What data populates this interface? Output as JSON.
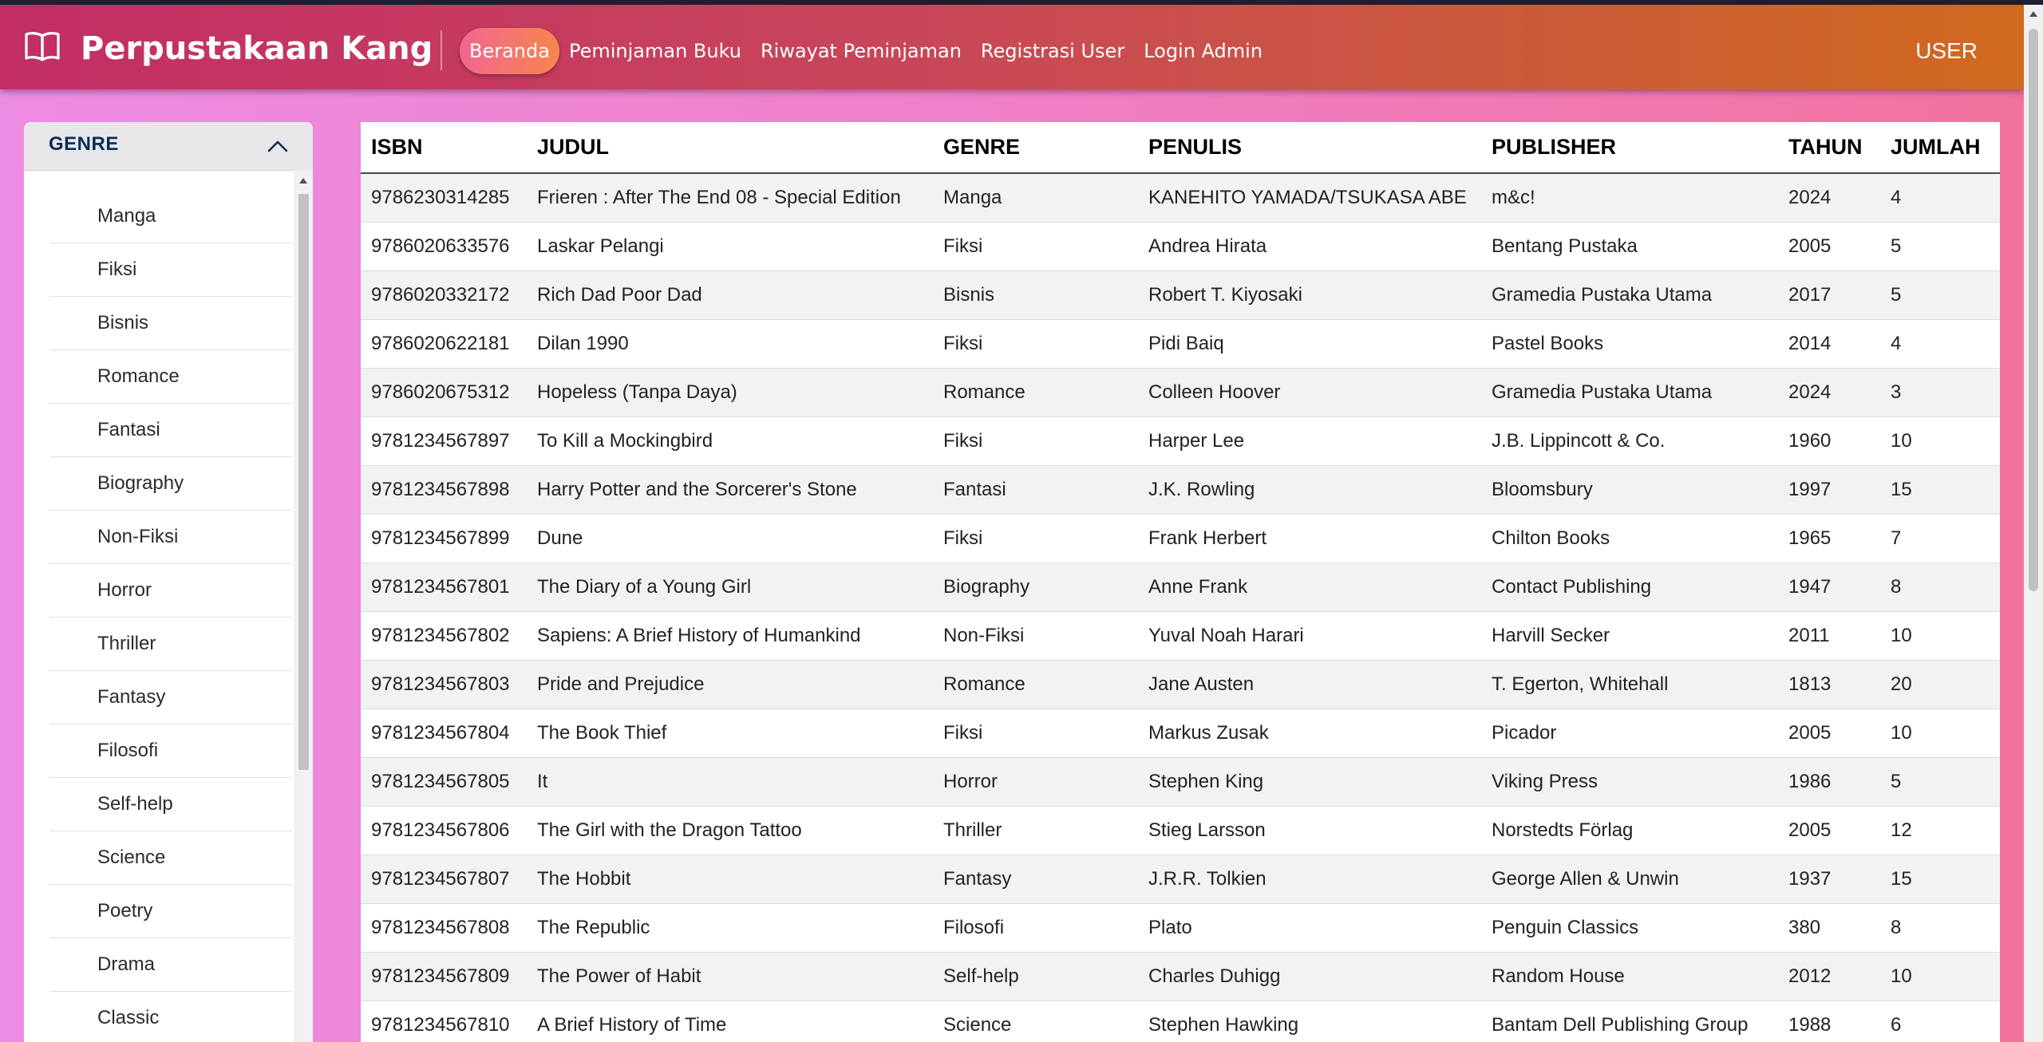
{
  "navbar": {
    "brand": "Perpustakaan Kang",
    "links": [
      "Beranda",
      "Peminjaman Buku",
      "Riwayat Peminjaman",
      "Registrasi User",
      "Login Admin"
    ],
    "user_label": "USER"
  },
  "sidebar": {
    "title": "GENRE",
    "genres": [
      "Manga",
      "Fiksi",
      "Bisnis",
      "Romance",
      "Fantasi",
      "Biography",
      "Non-Fiksi",
      "Horror",
      "Thriller",
      "Fantasy",
      "Filosofi",
      "Self-help",
      "Science",
      "Poetry",
      "Drama",
      "Classic"
    ]
  },
  "table": {
    "columns": [
      "ISBN",
      "JUDUL",
      "GENRE",
      "PENULIS",
      "PUBLISHER",
      "TAHUN",
      "JUMLAH"
    ],
    "rows": [
      [
        "9786230314285",
        "Frieren : After The End 08 - Special Edition",
        "Manga",
        "KANEHITO YAMADA/TSUKASA ABE",
        "m&c!",
        "2024",
        "4"
      ],
      [
        "9786020633576",
        "Laskar Pelangi",
        "Fiksi",
        "Andrea Hirata",
        "Bentang Pustaka",
        "2005",
        "5"
      ],
      [
        "9786020332172",
        "Rich Dad Poor Dad",
        "Bisnis",
        "Robert T. Kiyosaki",
        "Gramedia Pustaka Utama",
        "2017",
        "5"
      ],
      [
        "9786020622181",
        "Dilan 1990",
        "Fiksi",
        "Pidi Baiq",
        "Pastel Books",
        "2014",
        "4"
      ],
      [
        "9786020675312",
        "Hopeless (Tanpa Daya)",
        "Romance",
        "Colleen Hoover",
        "Gramedia Pustaka Utama",
        "2024",
        "3"
      ],
      [
        "9781234567897",
        "To Kill a Mockingbird",
        "Fiksi",
        "Harper Lee",
        "J.B. Lippincott & Co.",
        "1960",
        "10"
      ],
      [
        "9781234567898",
        "Harry Potter and the Sorcerer's Stone",
        "Fantasi",
        "J.K. Rowling",
        "Bloomsbury",
        "1997",
        "15"
      ],
      [
        "9781234567899",
        "Dune",
        "Fiksi",
        "Frank Herbert",
        "Chilton Books",
        "1965",
        "7"
      ],
      [
        "9781234567801",
        "The Diary of a Young Girl",
        "Biography",
        "Anne Frank",
        "Contact Publishing",
        "1947",
        "8"
      ],
      [
        "9781234567802",
        "Sapiens: A Brief History of Humankind",
        "Non-Fiksi",
        "Yuval Noah Harari",
        "Harvill Secker",
        "2011",
        "10"
      ],
      [
        "9781234567803",
        "Pride and Prejudice",
        "Romance",
        "Jane Austen",
        "T. Egerton, Whitehall",
        "1813",
        "20"
      ],
      [
        "9781234567804",
        "The Book Thief",
        "Fiksi",
        "Markus Zusak",
        "Picador",
        "2005",
        "10"
      ],
      [
        "9781234567805",
        "It",
        "Horror",
        "Stephen King",
        "Viking Press",
        "1986",
        "5"
      ],
      [
        "9781234567806",
        "The Girl with the Dragon Tattoo",
        "Thriller",
        "Stieg Larsson",
        "Norstedts Förlag",
        "2005",
        "12"
      ],
      [
        "9781234567807",
        "The Hobbit",
        "Fantasy",
        "J.R.R. Tolkien",
        "George Allen & Unwin",
        "1937",
        "15"
      ],
      [
        "9781234567808",
        "The Republic",
        "Filosofi",
        "Plato",
        "Penguin Classics",
        "380",
        "8"
      ],
      [
        "9781234567809",
        "The Power of Habit",
        "Self-help",
        "Charles Duhigg",
        "Random House",
        "2012",
        "10"
      ],
      [
        "9781234567810",
        "A Brief History of Time",
        "Science",
        "Stephen Hawking",
        "Bantam Dell Publishing Group",
        "1988",
        "6"
      ]
    ]
  },
  "icons": {
    "brand": "open-book-icon",
    "sidebar_toggle": "chevron-up-icon"
  },
  "colors": {
    "navbar_start": "#c22d66",
    "navbar_end": "#d0691e",
    "background": "#ef82cf",
    "sidebar_title": "#0c2b57",
    "active_pill": "#f4765f"
  }
}
